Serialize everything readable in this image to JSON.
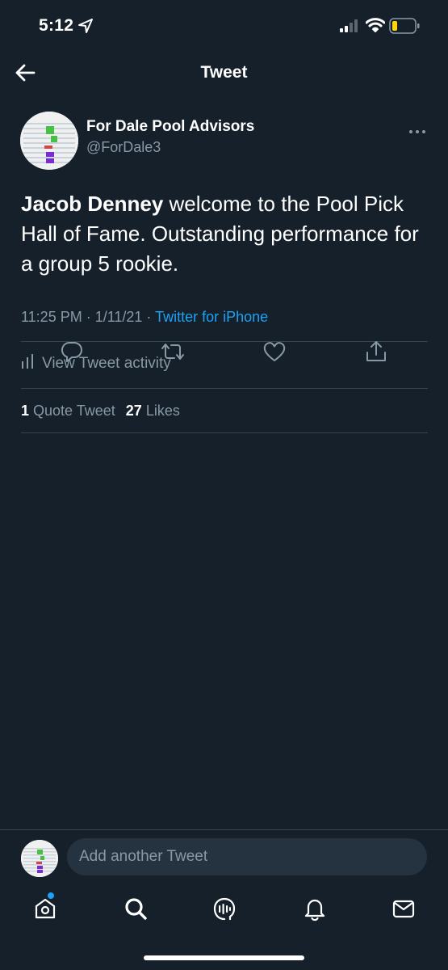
{
  "status_bar": {
    "time": "5:12"
  },
  "header": {
    "title": "Tweet",
    "back_icon": "arrow-left-icon"
  },
  "tweet": {
    "author_name": "For Dale Pool Advisors",
    "author_handle": "@ForDale3",
    "text_bold": "Jacob Denney",
    "text_rest": " welcome to the Pool Pick Hall of Fame. Outstanding performance for a group 5 rookie.",
    "timestamp": "11:25 PM · 1/11/21 · ",
    "source": "Twitter for iPhone",
    "activity_label": "View Tweet activity",
    "quote_count": "1",
    "quote_label": "Quote Tweet",
    "like_count": "27",
    "like_label": "Likes"
  },
  "actions": {
    "icons": [
      "reply-icon",
      "retweet-icon",
      "like-icon",
      "share-icon"
    ]
  },
  "compose": {
    "placeholder": "Add another Tweet"
  },
  "tab_bar": {
    "icons": [
      "home-icon",
      "search-icon",
      "spaces-icon",
      "notifications-icon",
      "messages-icon"
    ]
  },
  "colors": {
    "background": "#15202b",
    "text_secondary": "#8899a6",
    "accent": "#1da1f2",
    "divider": "#38444d",
    "battery_low": "#ffd60a"
  }
}
